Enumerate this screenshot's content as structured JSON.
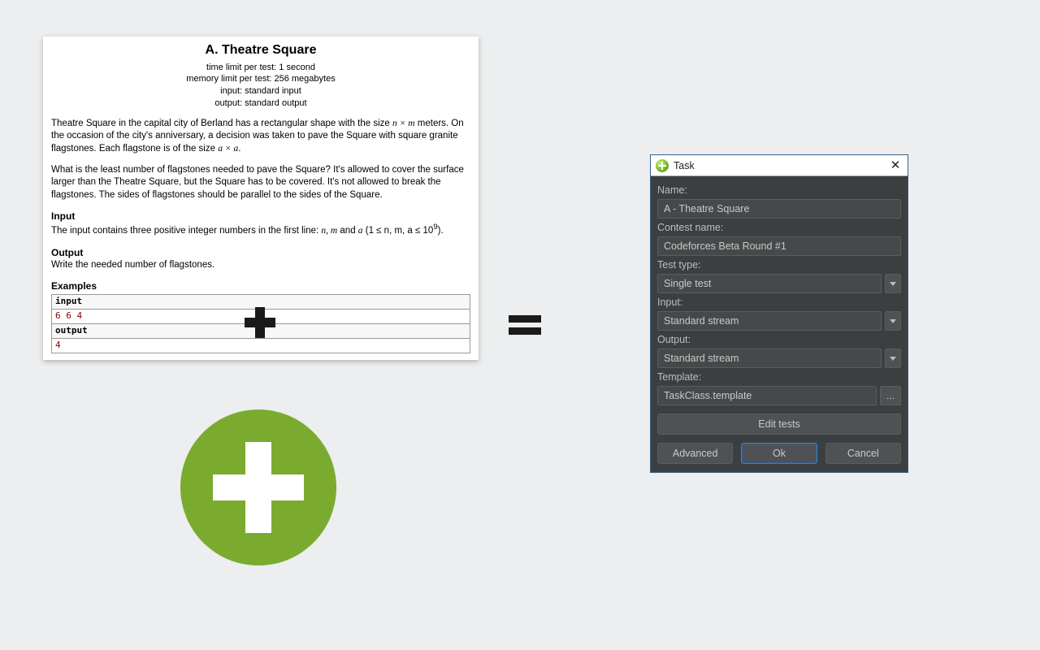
{
  "problem": {
    "title": "A. Theatre Square",
    "meta": {
      "time": "time limit per test: 1 second",
      "memory": "memory limit per test: 256 megabytes",
      "input": "input: standard input",
      "output": "output: standard output"
    },
    "para1_a": "Theatre Square in the capital city of Berland has a rectangular shape with the size ",
    "para1_m": "n × m",
    "para1_b": " meters. On the occasion of the city's anniversary, a decision was taken to pave the Square with square granite flagstones. Each flagstone is of the size ",
    "para1_c": "a × a",
    "para1_d": ".",
    "para2": "What is the least number of flagstones needed to pave the Square? It's allowed to cover the surface larger than the Theatre Square, but the Square has to be covered. It's not allowed to break the flagstones. The sides of flagstones should be parallel to the sides of the Square.",
    "input_h": "Input",
    "input_t_a": "The input contains three positive integer numbers in the first line: ",
    "input_t_b": "n,  m",
    "input_t_c": " and ",
    "input_t_d": "a",
    "input_t_e": " (1 ≤ n, m, a ≤ 10",
    "input_t_f": "9",
    "input_t_g": ").",
    "output_h": "Output",
    "output_t": "Write the needed number of flagstones.",
    "examples_h": "Examples",
    "ex_in_label": "input",
    "ex_in_val": "6 6 4",
    "ex_out_label": "output",
    "ex_out_val": "4"
  },
  "dialog": {
    "title": "Task",
    "labels": {
      "name": "Name:",
      "contest": "Contest name:",
      "testtype": "Test type:",
      "input": "Input:",
      "output": "Output:",
      "template": "Template:"
    },
    "name_value": "A - Theatre Square",
    "contest_value": "Codeforces Beta Round #1",
    "testtype_value": "Single test",
    "input_value": "Standard stream",
    "output_value": "Standard stream",
    "template_value": "TaskClass.template",
    "browse": "...",
    "edit_tests": "Edit tests",
    "advanced": "Advanced",
    "ok": "Ok",
    "cancel": "Cancel"
  }
}
